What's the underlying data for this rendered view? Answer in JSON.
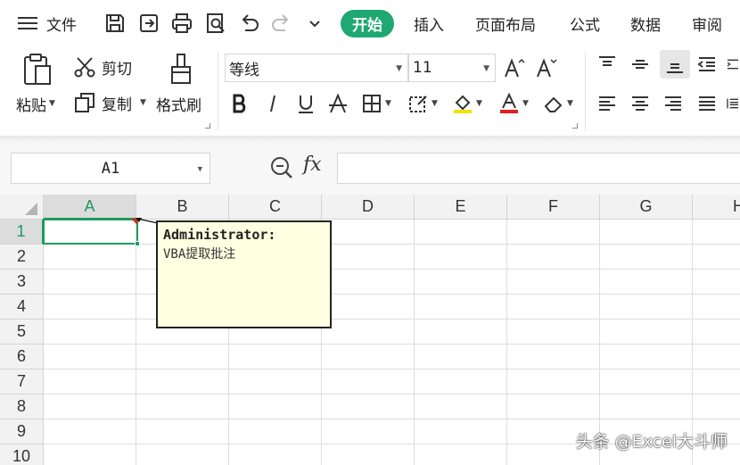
{
  "menubar": {
    "file_label": "文件",
    "tabs": [
      {
        "label": "开始",
        "active": true
      },
      {
        "label": "插入",
        "active": false
      },
      {
        "label": "页面布局",
        "active": false
      },
      {
        "label": "公式",
        "active": false
      },
      {
        "label": "数据",
        "active": false
      },
      {
        "label": "审阅",
        "active": false
      }
    ],
    "quick_access_icons": [
      "save-icon",
      "export-icon",
      "print-icon",
      "print-preview-icon",
      "undo-icon",
      "redo-icon",
      "customize-chevron-icon"
    ]
  },
  "ribbon": {
    "paste_label": "粘贴",
    "cut_label": "剪切",
    "copy_label": "复制",
    "format_painter_label": "格式刷",
    "font_name": "等线",
    "font_size": "11",
    "font_color": "#e02020",
    "fill_color": "#f2e200"
  },
  "formula_bar": {
    "name_box": "A1",
    "fx_label": "fx",
    "formula_value": ""
  },
  "sheet": {
    "columns": [
      "A",
      "B",
      "C",
      "D",
      "E",
      "F",
      "G",
      "H"
    ],
    "rows": [
      "1",
      "2",
      "3",
      "4",
      "5",
      "6",
      "7",
      "8",
      "9",
      "10"
    ],
    "active_cell": "A1",
    "accent_color": "#1e9b60"
  },
  "comment": {
    "author": "Administrator:",
    "text": "VBA提取批注"
  },
  "watermark": "头条 @Excel大斗师"
}
